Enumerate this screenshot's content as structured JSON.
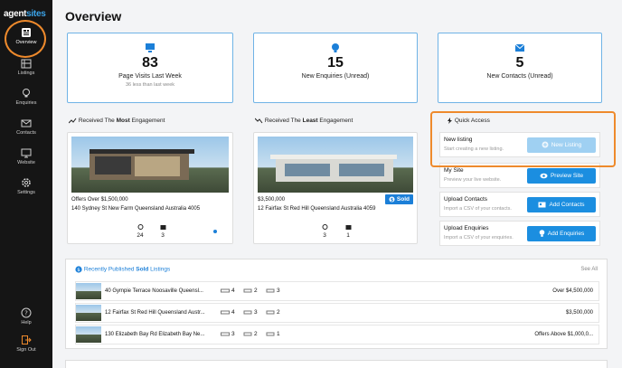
{
  "app": {
    "logo_prefix": "agent",
    "logo_suffix": "sites"
  },
  "colors": {
    "accent": "#1b8ee0",
    "sidebar_bg": "#151515",
    "highlight": "#ee8a2c"
  },
  "sidebar": {
    "items": [
      {
        "label": "Overview",
        "icon": "overview-icon"
      },
      {
        "label": "Listings",
        "icon": "listings-icon"
      },
      {
        "label": "Enquiries",
        "icon": "enquiries-icon"
      },
      {
        "label": "Contacts",
        "icon": "contacts-icon"
      },
      {
        "label": "Website",
        "icon": "website-icon"
      },
      {
        "label": "Settings",
        "icon": "settings-icon"
      }
    ],
    "footer": [
      {
        "label": "Help",
        "icon": "help-icon"
      },
      {
        "label": "Sign Out",
        "icon": "sign-out-icon"
      }
    ]
  },
  "page": {
    "title": "Overview"
  },
  "stats": [
    {
      "value": "83",
      "label": "Page Visits Last Week",
      "sub": "36 less than last week",
      "icon": "monitor-icon"
    },
    {
      "value": "15",
      "label": "New Enquiries (Unread)",
      "sub": "",
      "icon": "lightbulb-icon"
    },
    {
      "value": "5",
      "label": "New Contacts (Unread)",
      "sub": "",
      "icon": "envelope-icon"
    }
  ],
  "engagement": {
    "most": {
      "prefix": "Received The ",
      "bold": "Most",
      "suffix": " Engagement",
      "price": "Offers Over $1,500,000",
      "address": "140 Sydney St New Farm Queensland Australia 4005",
      "enquiries": "24",
      "contacts": "3"
    },
    "least": {
      "prefix": "Received The ",
      "bold": "Least",
      "suffix": " Engagement",
      "price": "$3,500,000",
      "address": "12 Fairfax St Red Hill Queensland Australia 4059",
      "badge": "Sold",
      "enquiries": "3",
      "contacts": "1"
    }
  },
  "quick_access": {
    "title": "Quick Access",
    "items": [
      {
        "title": "New listing",
        "subtitle": "Start creating a new listing.",
        "button": "New Listing"
      },
      {
        "title": "My Site",
        "subtitle": "Preview your live website.",
        "button": "Preview Site"
      },
      {
        "title": "Upload Contacts",
        "subtitle": "Import a CSV of your contacts.",
        "button": "Add Contacts"
      },
      {
        "title": "Upload Enquiries",
        "subtitle": "Import a CSV of your enquiries.",
        "button": "Add Enquiries"
      }
    ]
  },
  "listings": {
    "head_prefix": "Recently Published ",
    "head_bold": "Sold",
    "head_suffix": " Listings",
    "see_all": "See All",
    "rows": [
      {
        "address": "40 Gympie Terrace Noosaville Queensl...",
        "beds": "4",
        "baths": "2",
        "cars": "3",
        "price": "Over $4,500,000"
      },
      {
        "address": "12 Fairfax St Red Hill Queensland Austr...",
        "beds": "4",
        "baths": "3",
        "cars": "2",
        "price": "$3,500,000"
      },
      {
        "address": "130 Elizabeth Bay Rd Elizabeth Bay Ne...",
        "beds": "3",
        "baths": "2",
        "cars": "1",
        "price": "Offers Above $1,000,0..."
      }
    ]
  }
}
